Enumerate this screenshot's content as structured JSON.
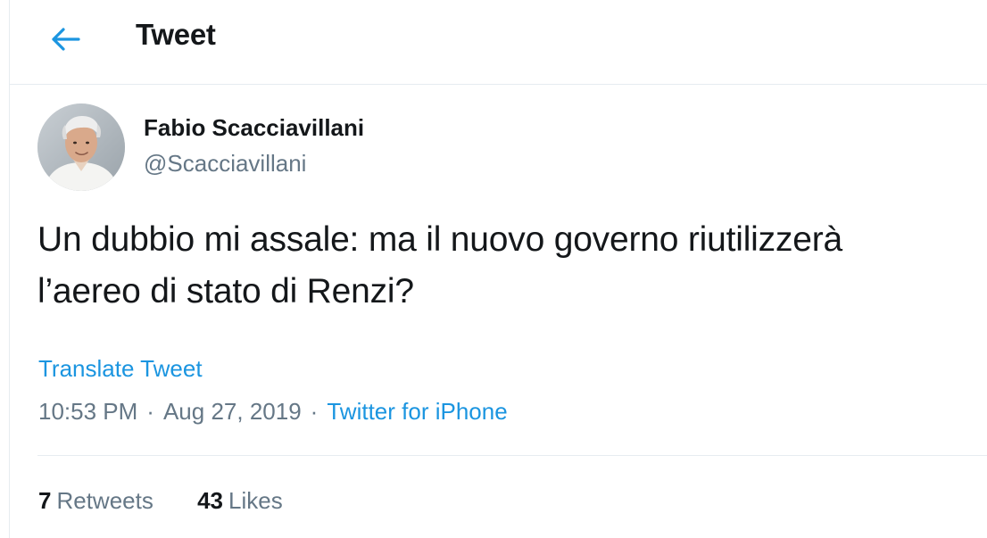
{
  "header": {
    "back_icon": "arrow-left-icon",
    "title": "Tweet"
  },
  "author": {
    "name": "Fabio Scacciavillani",
    "handle": "@Scacciavillani"
  },
  "tweet": {
    "text_line1": "Un dubbio mi assale: ma il nuovo governo riutilizzerà",
    "text_line2": "l’aereo di stato di Renzi?",
    "translate_label": "Translate Tweet",
    "time": "10:53 PM",
    "separator": "·",
    "date": "Aug 27, 2019",
    "source": "Twitter for iPhone"
  },
  "stats": {
    "retweets_count": "7",
    "retweets_label": "Retweets",
    "likes_count": "43",
    "likes_label": "Likes"
  },
  "colors": {
    "accent": "#1b95e0",
    "text_primary": "#14171a",
    "text_secondary": "#657786",
    "divider": "#e6ecf0"
  }
}
